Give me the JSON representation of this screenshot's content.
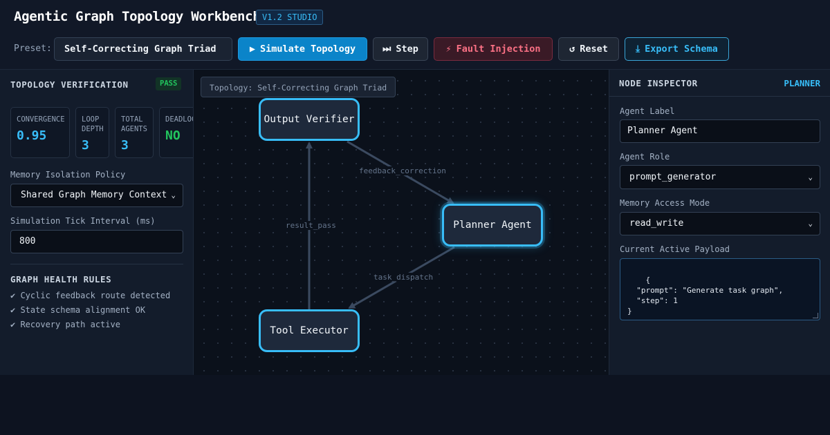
{
  "header": {
    "title": "Agentic Graph Topology Workbench",
    "version": "V1.2 STUDIO",
    "preset_label": "Preset:",
    "preset_value": "Self-Correcting Graph Triad"
  },
  "toolbar": {
    "simulate": {
      "icon": "play-icon",
      "glyph": "▶",
      "label": "Simulate Topology"
    },
    "step": {
      "icon": "step-icon",
      "glyph": "⏭",
      "label": "Step"
    },
    "fault": {
      "icon": "lightning-icon",
      "glyph": "⚡",
      "label": "Fault Injection"
    },
    "reset": {
      "icon": "reset-icon",
      "glyph": "↺",
      "label": "Reset"
    },
    "export": {
      "icon": "download-icon",
      "glyph": "⤓",
      "label": "Export Schema"
    }
  },
  "verification": {
    "title": "TOPOLOGY VERIFICATION",
    "status": "PASS",
    "stats": [
      {
        "label": "CONVERGENCE",
        "value": "0.95"
      },
      {
        "label": "LOOP DEPTH",
        "value": "3"
      },
      {
        "label": "TOTAL AGENTS",
        "value": "3"
      },
      {
        "label": "DEADLOCK",
        "value": "NO"
      }
    ],
    "memory_label": "Memory Isolation Policy",
    "memory_value": "Shared Graph Memory Context",
    "tick_label": "Simulation Tick Interval (ms)",
    "tick_value": "800",
    "rules_title": "GRAPH HEALTH RULES",
    "rules": [
      "✔ Cyclic feedback route detected",
      "✔ State schema alignment OK",
      "✔ Recovery path active"
    ]
  },
  "canvas": {
    "topology_label": "Topology: Self-Correcting Graph Triad",
    "nodes": {
      "verifier": "Output Verifier",
      "planner": "Planner Agent",
      "executor": "Tool Executor"
    },
    "edges": {
      "feedback": "feedback_correction",
      "result": "result_pass",
      "dispatch": "task_dispatch"
    }
  },
  "inspector": {
    "title": "NODE INSPECTOR",
    "selected_node": "PLANNER",
    "agent_label_label": "Agent Label",
    "agent_label_value": "Planner Agent",
    "agent_role_label": "Agent Role",
    "agent_role_value": "prompt_generator",
    "memory_mode_label": "Memory Access Mode",
    "memory_mode_value": "read_write",
    "payload_label": "Current Active Payload",
    "payload": "{\n  \"prompt\": \"Generate task graph\",\n  \"step\": 1\n}"
  },
  "colors": {
    "accent": "#38bdf8",
    "pass": "#22c55e",
    "fault": "#fb7185",
    "background": "#0d1320"
  }
}
